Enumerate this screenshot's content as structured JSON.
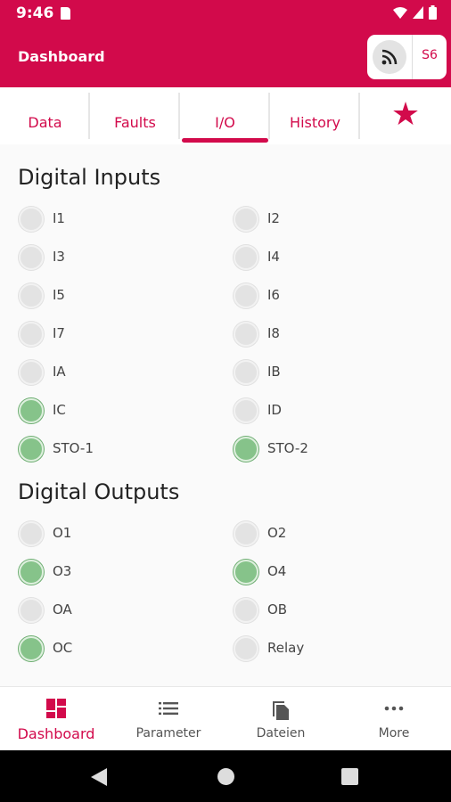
{
  "status_bar": {
    "time": "9:46"
  },
  "app_bar": {
    "title": "Dashboard",
    "device_label": "S6"
  },
  "tabs": [
    {
      "label": "Data"
    },
    {
      "label": "Faults"
    },
    {
      "label": "I/O"
    },
    {
      "label": "History"
    }
  ],
  "active_tab": "I/O",
  "digital_inputs": {
    "title": "Digital Inputs",
    "items": [
      {
        "label": "I1",
        "active": false
      },
      {
        "label": "I2",
        "active": false
      },
      {
        "label": "I3",
        "active": false
      },
      {
        "label": "I4",
        "active": false
      },
      {
        "label": "I5",
        "active": false
      },
      {
        "label": "I6",
        "active": false
      },
      {
        "label": "I7",
        "active": false
      },
      {
        "label": "I8",
        "active": false
      },
      {
        "label": "IA",
        "active": false
      },
      {
        "label": "IB",
        "active": false
      },
      {
        "label": "IC",
        "active": true
      },
      {
        "label": "ID",
        "active": false
      },
      {
        "label": "STO-1",
        "active": true
      },
      {
        "label": "STO-2",
        "active": true
      }
    ]
  },
  "digital_outputs": {
    "title": "Digital Outputs",
    "items": [
      {
        "label": "O1",
        "active": false
      },
      {
        "label": "O2",
        "active": false
      },
      {
        "label": "O3",
        "active": true
      },
      {
        "label": "O4",
        "active": true
      },
      {
        "label": "OA",
        "active": false
      },
      {
        "label": "OB",
        "active": false
      },
      {
        "label": "OC",
        "active": true
      },
      {
        "label": "Relay",
        "active": false
      }
    ]
  },
  "bottom_nav": [
    {
      "label": "Dashboard"
    },
    {
      "label": "Parameter"
    },
    {
      "label": "Dateien"
    },
    {
      "label": "More"
    }
  ],
  "colors": {
    "brand": "#d20a4b",
    "led_on": "#86c38a",
    "led_off": "#e3e3e3"
  }
}
